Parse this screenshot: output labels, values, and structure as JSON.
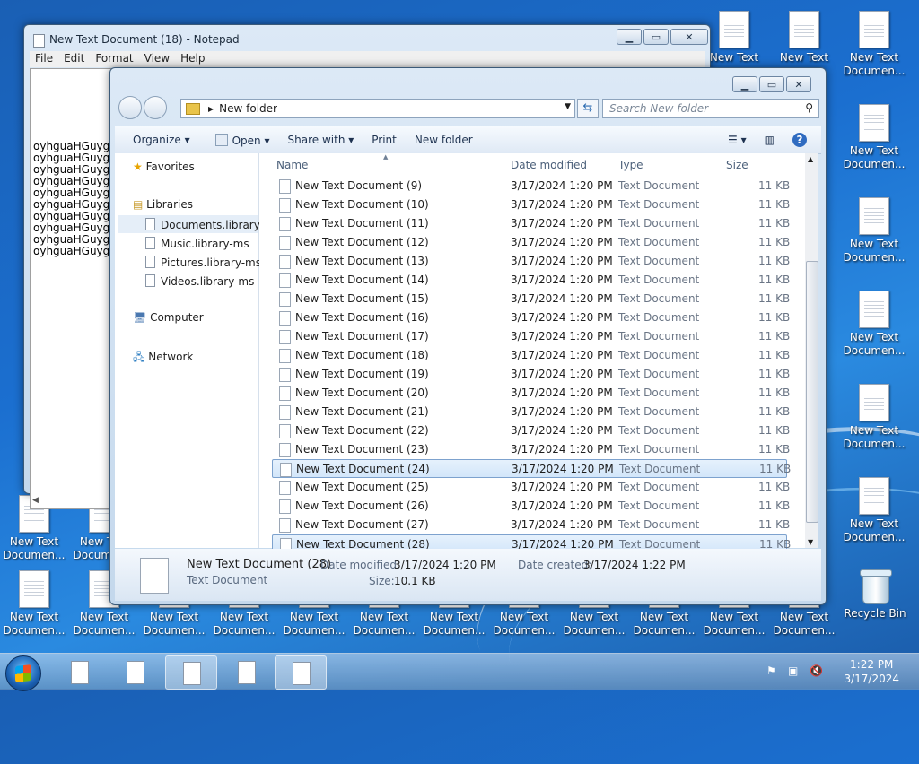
{
  "desktop": {
    "icons_right_col": [
      "New Text",
      "New Text",
      "New Text Documen...",
      "New Text Documen...",
      "New Text Documen...",
      "New Text Documen...",
      "New Text Documen...",
      "New Text Documen..."
    ],
    "icons_bottom_row": [
      "New Text Documen...",
      "New Text Documen...",
      "New Text Documen...",
      "New Text Documen...",
      "New Text Documen...",
      "New Text Documen...",
      "New Text Documen...",
      "New Text Documen...",
      "New Text Documen...",
      "New Text Documen...",
      "New Text Documen...",
      "New Text Documen..."
    ],
    "icons_left_partial": [
      "New Text Documen...",
      "New Text Documen..."
    ],
    "recycle_bin": "Recycle Bin"
  },
  "notepad": {
    "title": "New Text Document (18) - Notepad",
    "menu": [
      "File",
      "Edit",
      "Format",
      "View",
      "Help"
    ],
    "lines": [
      "oyhguaHGuyg",
      "oyhguaHGuyg",
      "oyhguaHGuyg",
      "oyhguaHGuyg",
      "oyhguaHGuyg",
      "oyhguaHGuyg",
      "oyhguaHGuyg",
      "oyhguaHGuyg",
      "oyhguaHGuyg",
      "oyhguaHGuyg"
    ]
  },
  "explorer": {
    "breadcrumb": "New folder",
    "search_placeholder": "Search New folder",
    "toolbar": {
      "organize": "Organize",
      "open": "Open",
      "share": "Share with",
      "print": "Print",
      "new_folder": "New folder"
    },
    "nav": {
      "favorites": "Favorites",
      "libraries": "Libraries",
      "lib_items": [
        "Documents.library-r",
        "Music.library-ms",
        "Pictures.library-ms",
        "Videos.library-ms"
      ],
      "computer": "Computer",
      "network": "Network"
    },
    "columns": {
      "name": "Name",
      "date": "Date modified",
      "type": "Type",
      "size": "Size"
    },
    "files": [
      {
        "name": "New Text Document (9)",
        "date": "3/17/2024 1:20 PM",
        "type": "Text Document",
        "size": "11 KB"
      },
      {
        "name": "New Text Document (10)",
        "date": "3/17/2024 1:20 PM",
        "type": "Text Document",
        "size": "11 KB"
      },
      {
        "name": "New Text Document (11)",
        "date": "3/17/2024 1:20 PM",
        "type": "Text Document",
        "size": "11 KB"
      },
      {
        "name": "New Text Document (12)",
        "date": "3/17/2024 1:20 PM",
        "type": "Text Document",
        "size": "11 KB"
      },
      {
        "name": "New Text Document (13)",
        "date": "3/17/2024 1:20 PM",
        "type": "Text Document",
        "size": "11 KB"
      },
      {
        "name": "New Text Document (14)",
        "date": "3/17/2024 1:20 PM",
        "type": "Text Document",
        "size": "11 KB"
      },
      {
        "name": "New Text Document (15)",
        "date": "3/17/2024 1:20 PM",
        "type": "Text Document",
        "size": "11 KB"
      },
      {
        "name": "New Text Document (16)",
        "date": "3/17/2024 1:20 PM",
        "type": "Text Document",
        "size": "11 KB"
      },
      {
        "name": "New Text Document (17)",
        "date": "3/17/2024 1:20 PM",
        "type": "Text Document",
        "size": "11 KB"
      },
      {
        "name": "New Text Document (18)",
        "date": "3/17/2024 1:20 PM",
        "type": "Text Document",
        "size": "11 KB"
      },
      {
        "name": "New Text Document (19)",
        "date": "3/17/2024 1:20 PM",
        "type": "Text Document",
        "size": "11 KB"
      },
      {
        "name": "New Text Document (20)",
        "date": "3/17/2024 1:20 PM",
        "type": "Text Document",
        "size": "11 KB"
      },
      {
        "name": "New Text Document (21)",
        "date": "3/17/2024 1:20 PM",
        "type": "Text Document",
        "size": "11 KB"
      },
      {
        "name": "New Text Document (22)",
        "date": "3/17/2024 1:20 PM",
        "type": "Text Document",
        "size": "11 KB"
      },
      {
        "name": "New Text Document (23)",
        "date": "3/17/2024 1:20 PM",
        "type": "Text Document",
        "size": "11 KB"
      },
      {
        "name": "New Text Document (24)",
        "date": "3/17/2024 1:20 PM",
        "type": "Text Document",
        "size": "11 KB"
      },
      {
        "name": "New Text Document (25)",
        "date": "3/17/2024 1:20 PM",
        "type": "Text Document",
        "size": "11 KB"
      },
      {
        "name": "New Text Document (26)",
        "date": "3/17/2024 1:20 PM",
        "type": "Text Document",
        "size": "11 KB"
      },
      {
        "name": "New Text Document (27)",
        "date": "3/17/2024 1:20 PM",
        "type": "Text Document",
        "size": "11 KB"
      },
      {
        "name": "New Text Document (28)",
        "date": "3/17/2024 1:20 PM",
        "type": "Text Document",
        "size": "11 KB"
      }
    ],
    "details": {
      "name": "New Text Document (28)",
      "type": "Text Document",
      "modified_label": "Date modified:",
      "modified": "3/17/2024 1:20 PM",
      "created_label": "Date created:",
      "created": "3/17/2024 1:22 PM",
      "size_label": "Size:",
      "size": "10.1 KB"
    }
  },
  "taskbar": {
    "time": "1:22 PM",
    "date": "3/17/2024"
  }
}
